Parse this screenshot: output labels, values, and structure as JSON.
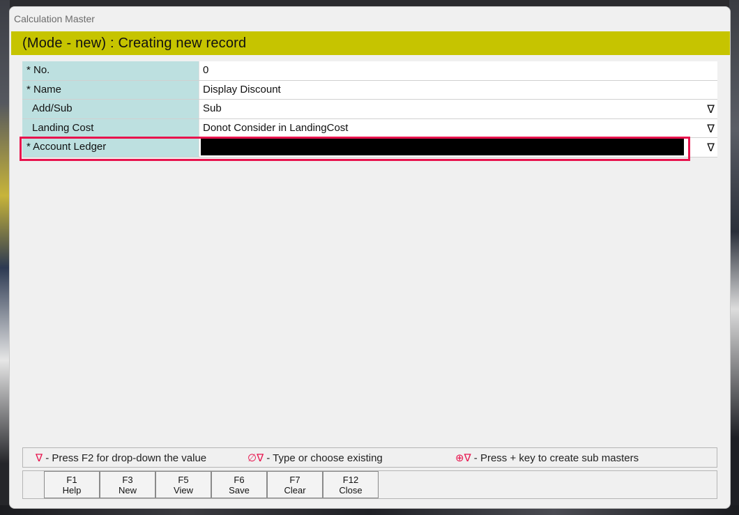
{
  "window": {
    "title": "Calculation Master"
  },
  "mode_banner": "(Mode - new) : Creating new record",
  "fields": [
    {
      "label": "* No.",
      "value": "0",
      "dropdown": false
    },
    {
      "label": "* Name",
      "value": "Display Discount",
      "dropdown": false
    },
    {
      "label": "Add/Sub",
      "value": "Sub",
      "dropdown": true
    },
    {
      "label": "Landing Cost",
      "value": "Donot Consider in LandingCost",
      "dropdown": true
    },
    {
      "label": "* Account Ledger",
      "value": "",
      "dropdown": true
    }
  ],
  "dropdown_glyph": "∇",
  "legend": [
    {
      "symbol": "∇",
      "text": " - Press F2 for drop-down the value"
    },
    {
      "symbol": "∅∇",
      "text": " - Type or choose existing"
    },
    {
      "symbol": "⊕∇",
      "text": " - Press + key to create sub masters"
    }
  ],
  "function_keys": [
    {
      "key": "F1",
      "label": "Help"
    },
    {
      "key": "F3",
      "label": "New"
    },
    {
      "key": "F5",
      "label": "View"
    },
    {
      "key": "F6",
      "label": "Save"
    },
    {
      "key": "F7",
      "label": "Clear"
    },
    {
      "key": "F12",
      "label": "Close"
    }
  ],
  "colors": {
    "mode_banner": "#c6c400",
    "label_cell": "#bde0e0",
    "highlight": "#e8134d",
    "active_input": "#000000"
  }
}
